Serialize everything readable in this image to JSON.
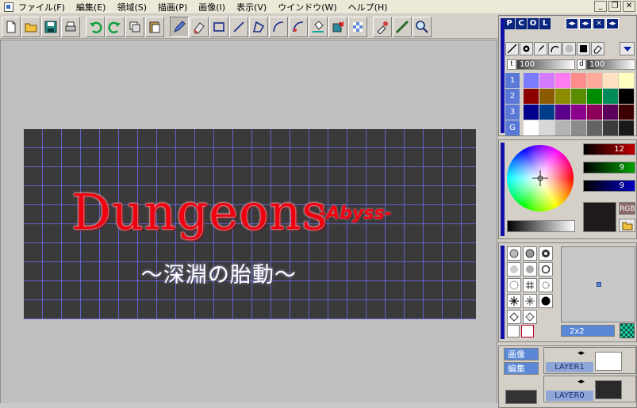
{
  "menu": [
    "ファイル(F)",
    "編集(E)",
    "領域(S)",
    "描画(P)",
    "画像(I)",
    "表示(V)",
    "ウインドウ(W)",
    "ヘルプ(H)"
  ],
  "window_controls": {
    "minimize": "_",
    "restore": "❐",
    "close": "✕"
  },
  "canvas": {
    "title": "Dungeons",
    "subtitle": "-Abyss-",
    "tagline": "〜深淵の胎動〜"
  },
  "color_panel": {
    "tabs": [
      "P",
      "C",
      "O",
      "L"
    ],
    "controls": [
      "◂▸",
      "◂▸",
      "✕",
      "◂▸"
    ],
    "thickness_label": "t",
    "thickness_value": "100",
    "density_label": "d",
    "density_value": "100",
    "palette_rows": [
      "1",
      "2",
      "3",
      "G"
    ],
    "palette": [
      "#7b7bff",
      "#d27bff",
      "#ff7bf0",
      "#ff8c8c",
      "#ffaa9a",
      "#ffe0c0",
      "#ffffc0",
      "#8c0000",
      "#8c5a00",
      "#8c8c00",
      "#5a8c00",
      "#008c00",
      "#008c5a",
      "#000000",
      "#00008c",
      "#003c8c",
      "#5a008c",
      "#8c008c",
      "#8c005a",
      "#5a005a",
      "#3c0000",
      "#ffffff",
      "#d8d8d8",
      "#b4b4b4",
      "#8c8c8c",
      "#646464",
      "#3c3c3c",
      "#1a1a1a"
    ]
  },
  "color_picker": {
    "r": "12",
    "g": "9",
    "b": "9",
    "mode": "RGB",
    "colors": {
      "r": "#8c0000",
      "g": "#006400",
      "b": "#000096"
    }
  },
  "brush_panel": {
    "size": "2x2"
  },
  "layer_panel": {
    "buttons": [
      "画像",
      "編集"
    ],
    "layers": [
      {
        "name": "LAYER1"
      },
      {
        "name": "LAYER0"
      }
    ]
  },
  "colors": {
    "title_red": "#ee0010",
    "grid_blue": "#6e6eff",
    "canvas_bg": "#3a3a3a"
  }
}
